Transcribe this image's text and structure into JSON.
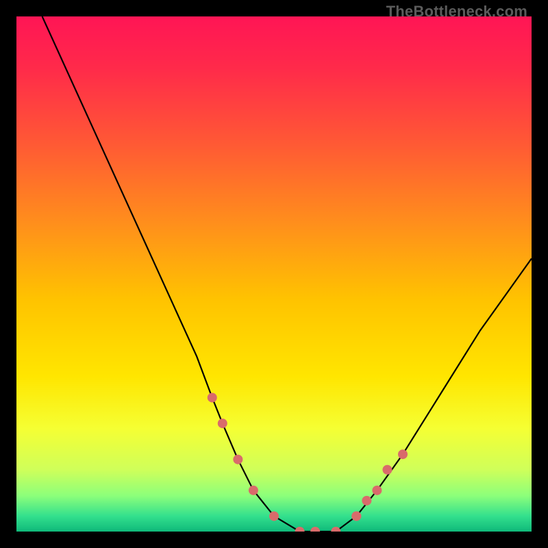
{
  "watermark": "TheBottleneck.com",
  "chart_data": {
    "type": "line",
    "title": "",
    "xlabel": "",
    "ylabel": "",
    "xlim": [
      0,
      100
    ],
    "ylim": [
      0,
      100
    ],
    "grid": false,
    "legend": false,
    "series": [
      {
        "name": "curve",
        "color": "#000000",
        "x": [
          5,
          10,
          15,
          20,
          25,
          30,
          35,
          38,
          40,
          43,
          46,
          50,
          55,
          58,
          62,
          66,
          70,
          75,
          80,
          85,
          90,
          95,
          100
        ],
        "y": [
          100,
          89,
          78,
          67,
          56,
          45,
          34,
          26,
          21,
          14,
          8,
          3,
          0,
          0,
          0,
          3,
          8,
          15,
          23,
          31,
          39,
          46,
          53
        ]
      }
    ],
    "markers": [
      {
        "name": "dots-left",
        "color": "#d96b6b",
        "points": [
          [
            38,
            26
          ],
          [
            40,
            21
          ],
          [
            43,
            14
          ],
          [
            46,
            8
          ],
          [
            50,
            3
          ]
        ]
      },
      {
        "name": "dots-bottom",
        "color": "#d96b6b",
        "points": [
          [
            55,
            0
          ],
          [
            58,
            0
          ],
          [
            62,
            0
          ],
          [
            66,
            3
          ]
        ]
      },
      {
        "name": "dots-right",
        "color": "#d96b6b",
        "points": [
          [
            66,
            3
          ],
          [
            68,
            6
          ],
          [
            70,
            8
          ],
          [
            72,
            12
          ],
          [
            75,
            15
          ]
        ]
      }
    ],
    "background_gradient": {
      "stops": [
        {
          "offset": 0.0,
          "color": "#ff1555"
        },
        {
          "offset": 0.1,
          "color": "#ff2a4a"
        },
        {
          "offset": 0.25,
          "color": "#ff5a34"
        },
        {
          "offset": 0.4,
          "color": "#ff8e1c"
        },
        {
          "offset": 0.55,
          "color": "#ffc300"
        },
        {
          "offset": 0.7,
          "color": "#ffe600"
        },
        {
          "offset": 0.8,
          "color": "#f5ff33"
        },
        {
          "offset": 0.88,
          "color": "#cfff5a"
        },
        {
          "offset": 0.93,
          "color": "#8dff7a"
        },
        {
          "offset": 0.97,
          "color": "#33e08d"
        },
        {
          "offset": 1.0,
          "color": "#0fb97a"
        }
      ]
    }
  }
}
